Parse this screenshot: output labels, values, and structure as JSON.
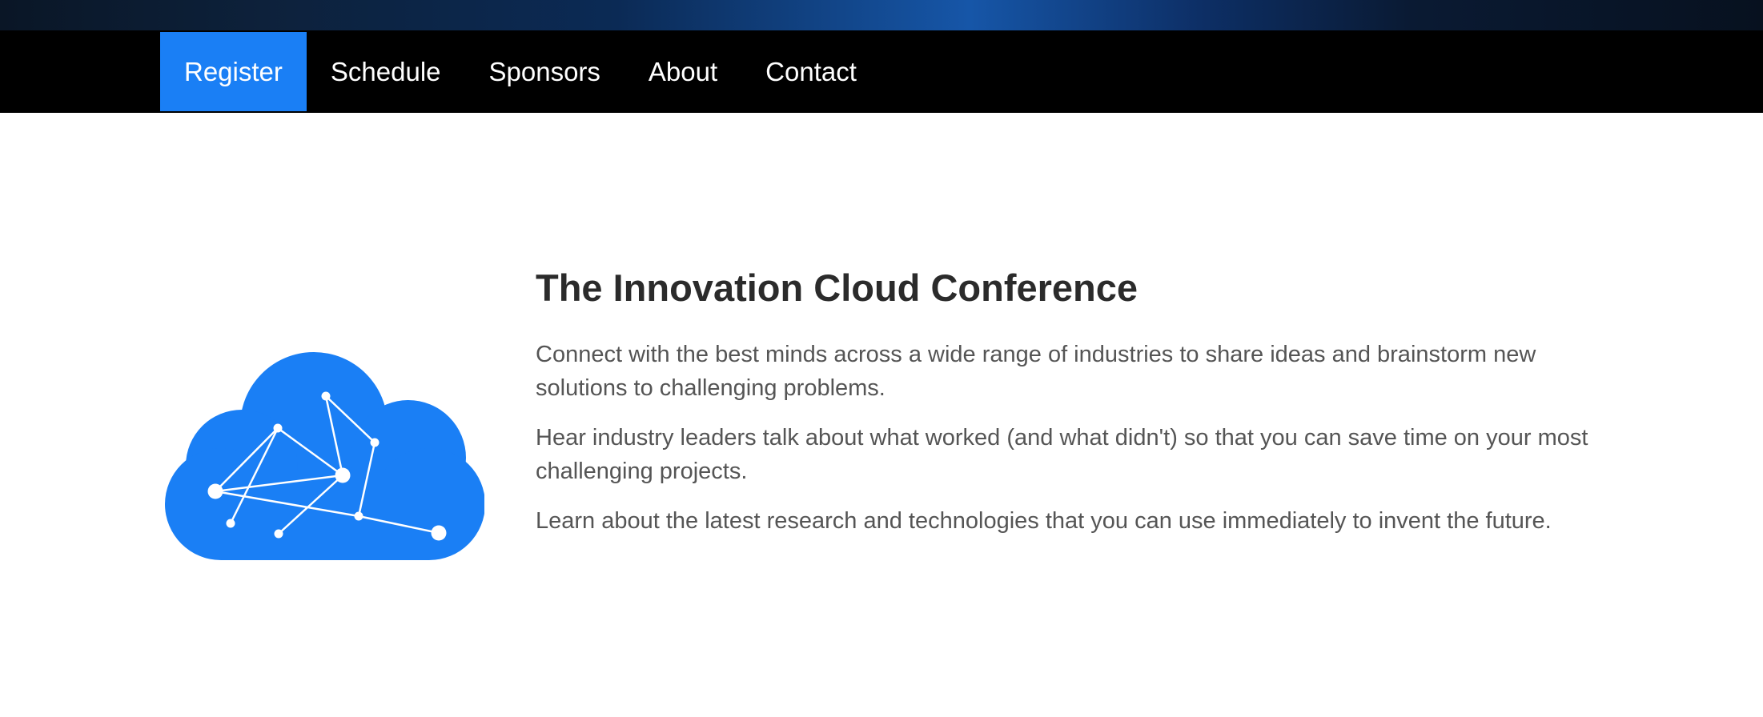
{
  "nav": {
    "items": [
      {
        "label": "Register",
        "active": true
      },
      {
        "label": "Schedule",
        "active": false
      },
      {
        "label": "Sponsors",
        "active": false
      },
      {
        "label": "About",
        "active": false
      },
      {
        "label": "Contact",
        "active": false
      }
    ]
  },
  "hero": {
    "title": "The Innovation Cloud Conference",
    "paragraphs": [
      "Connect with the best minds across a wide range of industries to share ideas and brainstorm new solutions to challenging problems.",
      "Hear industry leaders talk about what worked (and what didn't) so that you can save time on your most challenging projects.",
      "Learn about the latest research and technologies that you can use immediately to invent the future."
    ],
    "illustration": "cloud-network-icon"
  },
  "colors": {
    "accent": "#1a7ff5",
    "nav_background": "#000000",
    "title_text": "#2b2b2b",
    "body_text": "#555555"
  }
}
